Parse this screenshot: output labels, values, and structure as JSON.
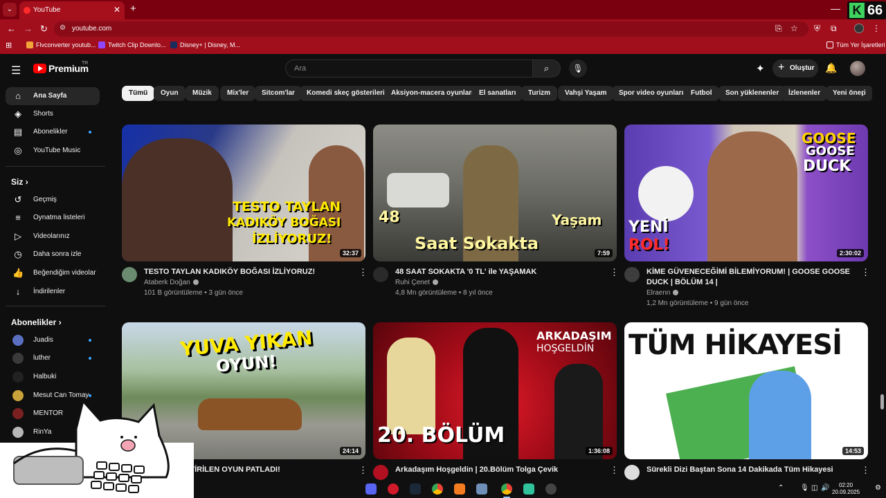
{
  "browser": {
    "tab_title": "YouTube",
    "url": "youtube.com",
    "badge_number": "66",
    "bookmarks": [
      "Flvconverter youtub...",
      "Twitch Clip Downlo...",
      "Disney+ | Disney, M..."
    ],
    "bookmarks_right": "Tüm Yer İşaretleri"
  },
  "header": {
    "brand": "Premium",
    "region": "TR",
    "search_placeholder": "Ara",
    "create_label": "Oluştur"
  },
  "chips": [
    "Tümü",
    "Oyun",
    "Müzik",
    "Mix'ler",
    "Sitcom'lar",
    "Komedi skeç gösterileri",
    "Aksiyon-macera oyunları",
    "El sanatları",
    "Turizm",
    "Vahşi Yaşam",
    "Spor video oyunları",
    "Futbol",
    "Son yüklenenler",
    "İzlenenler",
    "Yeni öneri"
  ],
  "sidebar": {
    "main": [
      "Ana Sayfa",
      "Shorts",
      "Abonelikler",
      "YouTube Music"
    ],
    "you_header": "Siz",
    "you": [
      "Geçmiş",
      "Oynatma listeleri",
      "Videolarınız",
      "Daha sonra izle",
      "Beğendiğim videolar",
      "İndirilenler"
    ],
    "subs_header": "Abonelikler",
    "subs": [
      "Juadis",
      "luther",
      "Halbuki",
      "Mesut Can Tomay",
      "MENTOR",
      "RinYa"
    ]
  },
  "videos": [
    {
      "title": "TESTO TAYLAN KADIKÖY BOĞASI İZLİYORUZ!",
      "channel": "Ataberk Doğan",
      "meta": "101 B görüntüleme • 3 gün önce",
      "duration": "32:37",
      "thumb_text": [
        "TESTO TAYLAN",
        "KADIKÖY BOĞASI",
        "İZLİYORUZ!"
      ]
    },
    {
      "title": "48 SAAT SOKAKTA '0 TL' ile YAŞAMAK",
      "channel": "Ruhi Çenet",
      "meta": "4,8 Mn görüntüleme • 8 yıl önce",
      "duration": "7:59",
      "thumb_text": [
        "48",
        "Yaşam",
        "Saat Sokakta"
      ]
    },
    {
      "title": "KİME GÜVENECEĞİMİ BİLEMİYORUM! | GOOSE GOOSE DUCK | BÖLÜM 14 |",
      "channel": "Elraenn",
      "meta": "1,2 Mn görüntüleme • 9 gün önce",
      "duration": "2:30:02",
      "thumb_text": [
        "GOOSE",
        "GOOSE",
        "DUCK",
        "YENİ",
        "ROL!"
      ]
    },
    {
      "title": "İŞTİRİLEN OYUN PATLADI!",
      "channel": "",
      "meta": "",
      "duration": "24:14",
      "thumb_text": [
        "YUVA YIKAN",
        "OYUN!"
      ]
    },
    {
      "title": "Arkadaşım Hoşgeldin | 20.Bölüm  Tolga Çevik",
      "channel": "",
      "meta": "",
      "duration": "1:36:08",
      "thumb_text": [
        "ARKADAŞIM",
        "HOŞGELDİN",
        "20. BÖLÜM"
      ]
    },
    {
      "title": "Sürekli Dizi Baştan Sona 14 Dakikada Tüm Hikayesi",
      "channel": "",
      "meta": "",
      "duration": "14:53",
      "thumb_text": [
        "TÜM HİKAYESİ"
      ]
    }
  ],
  "system": {
    "time": "02:20",
    "date": "20.09.2025"
  },
  "colors": {
    "browser_frame": "#a10f1d",
    "yt_red": "#ff0000",
    "bg": "#0f0f0f"
  }
}
